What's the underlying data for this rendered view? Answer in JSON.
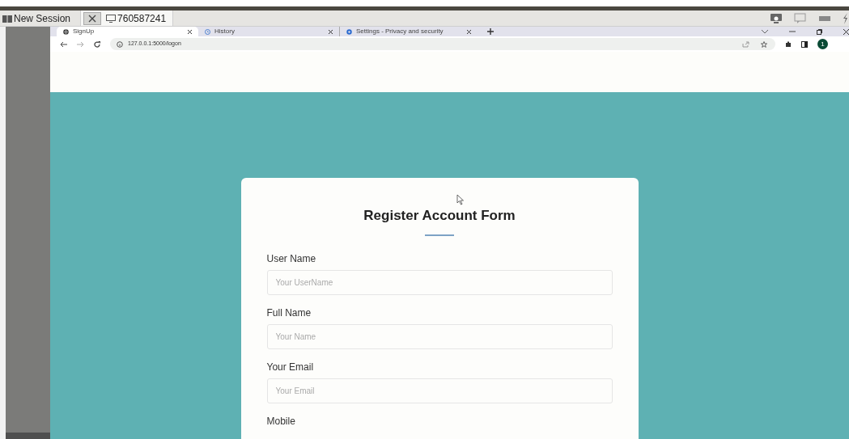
{
  "remote_toolbar": {
    "tabs": [
      {
        "label": "New Session",
        "kind": "session",
        "selected": false
      },
      {
        "label": "760587241",
        "kind": "remote",
        "selected": true
      }
    ]
  },
  "browser": {
    "tabs": [
      {
        "title": "SignUp",
        "kind": "globe",
        "selected": true
      },
      {
        "title": "History",
        "kind": "history",
        "selected": false
      },
      {
        "title": "Settings - Privacy and security",
        "kind": "gear",
        "selected": false
      }
    ],
    "url": "127.0.0.1:5000/logon",
    "profile_initial": "1"
  },
  "form": {
    "title": "Register Account Form",
    "fields": [
      {
        "label": "User Name",
        "placeholder": "Your UserName"
      },
      {
        "label": "Full Name",
        "placeholder": "Your Name"
      },
      {
        "label": "Your Email",
        "placeholder": "Your Email"
      },
      {
        "label": "Mobile"
      }
    ]
  }
}
